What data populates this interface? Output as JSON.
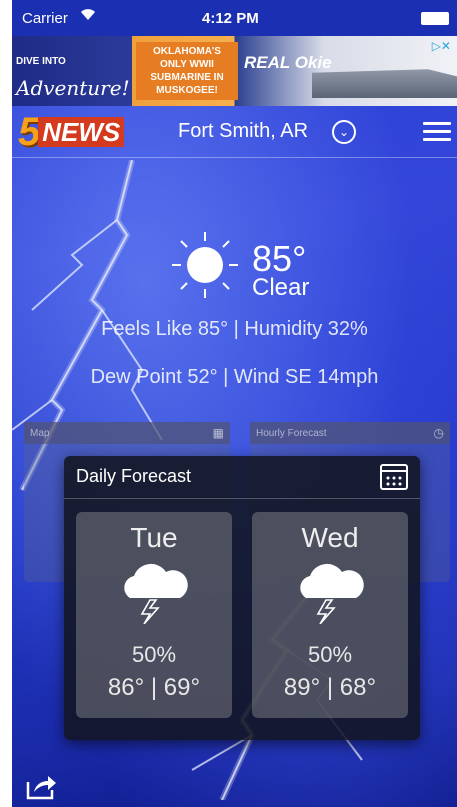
{
  "status_bar": {
    "carrier": "Carrier",
    "time": "4:12 PM"
  },
  "ad": {
    "left_line1": "DIVE INTO",
    "left_line2": "Adventure!",
    "promo": "OKLAHOMA'S ONLY WWII SUBMARINE IN MUSKOGEE!",
    "brand": "REAL Okie"
  },
  "header": {
    "logo_number": "5",
    "logo_text": "NEWS",
    "location": "Fort Smith, AR"
  },
  "current": {
    "temperature": "85°",
    "condition": "Clear",
    "details_line1": "Feels Like 85° | Humidity 32%",
    "details_line2": "Dew Point 52° | Wind SE 14mph"
  },
  "background_cards": {
    "map_label": "Map",
    "hourly_label": "Hourly Forecast"
  },
  "daily_forecast": {
    "title": "Daily Forecast",
    "days": [
      {
        "name": "Tue",
        "precip": "50%",
        "hilo": "86° | 69°",
        "icon": "thunderstorm-icon"
      },
      {
        "name": "Wed",
        "precip": "50%",
        "hilo": "89° | 68°",
        "icon": "thunderstorm-icon"
      }
    ]
  },
  "colors": {
    "background_blue": "#2a3fd6",
    "logo_orange": "#f5a11a",
    "card_dark": "#12141f"
  }
}
